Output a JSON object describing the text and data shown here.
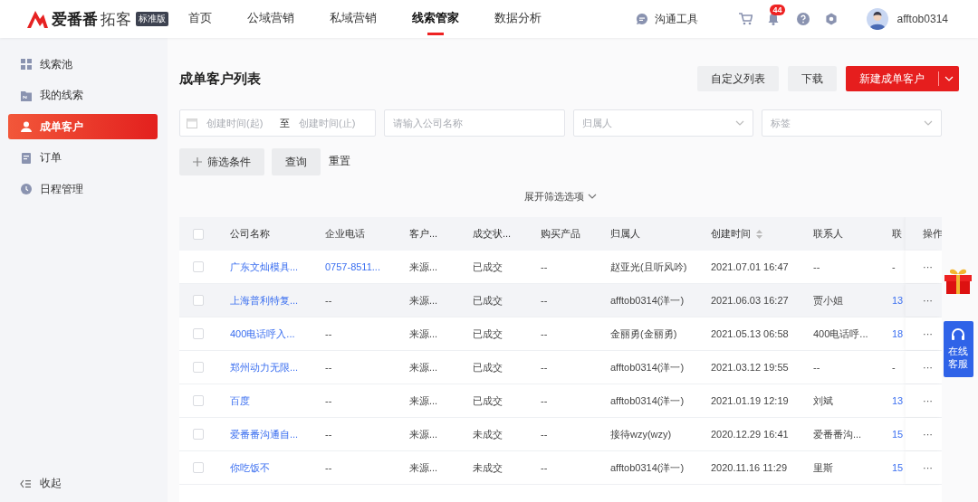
{
  "brand": {
    "name": "爱番番",
    "product": "拓客",
    "edition": "标准版"
  },
  "nav": [
    {
      "label": "首页",
      "selected": false
    },
    {
      "label": "公域营销",
      "selected": false
    },
    {
      "label": "私域营销",
      "selected": false
    },
    {
      "label": "线索管家",
      "selected": true
    },
    {
      "label": "数据分析",
      "selected": false
    }
  ],
  "toolbar": {
    "chat_tool": "沟通工具",
    "notification_count": "44",
    "username": "afftob0314"
  },
  "sidebar": {
    "items": [
      {
        "label": "线索池",
        "selected": false
      },
      {
        "label": "我的线索",
        "selected": false
      },
      {
        "label": "成单客户",
        "selected": true
      },
      {
        "label": "订单",
        "selected": false
      },
      {
        "label": "日程管理",
        "selected": false
      }
    ],
    "collapse": "收起"
  },
  "page": {
    "title": "成单客户列表",
    "buttons": [
      "自定义列表",
      "下载"
    ],
    "primary_button": "新建成单客户"
  },
  "filters": {
    "date_start": {
      "placeholder": "创建时间(起)"
    },
    "date_sep": "至",
    "date_end": {
      "placeholder": "创建时间(止)"
    },
    "company": {
      "placeholder": "请输入公司名称"
    },
    "owner": {
      "placeholder": "归属人"
    },
    "tag": {
      "placeholder": "标签"
    },
    "add_filter": "筛选条件",
    "query": "查询",
    "reset": "重置",
    "expand": "展开筛选选项"
  },
  "table": {
    "select_all_checked": false,
    "columns": [
      {
        "label": "公司名称",
        "sortable": false
      },
      {
        "label": "企业电话",
        "sortable": false
      },
      {
        "label": "客户...",
        "sortable": false
      },
      {
        "label": "成交状...",
        "sortable": false
      },
      {
        "label": "购买产品",
        "sortable": false
      },
      {
        "label": "归属人",
        "sortable": false
      },
      {
        "label": "创建时间",
        "sortable": true
      },
      {
        "label": "联系人",
        "sortable": false
      },
      {
        "label": "联",
        "sortable": false
      },
      {
        "label": "操作",
        "sortable": false
      }
    ],
    "rows": [
      {
        "checked": false,
        "highlighted": false,
        "cells": [
          {
            "text": "广东文灿模具...",
            "link": true
          },
          {
            "text": "0757-8511...",
            "link": true
          },
          {
            "text": "来源...",
            "link": false
          },
          {
            "text": "已成交",
            "link": false
          },
          {
            "text": "--",
            "link": false
          },
          {
            "text": "赵亚光(且听风吟)",
            "link": false
          },
          {
            "text": "2021.07.01 16:47",
            "link": false
          },
          {
            "text": "--",
            "link": false
          },
          {
            "text": "-",
            "link": false
          },
          {
            "text": "···",
            "link": false
          }
        ]
      },
      {
        "checked": false,
        "highlighted": true,
        "cells": [
          {
            "text": "上海普利特复...",
            "link": true
          },
          {
            "text": "--",
            "link": false
          },
          {
            "text": "来源...",
            "link": false
          },
          {
            "text": "已成交",
            "link": false
          },
          {
            "text": "--",
            "link": false
          },
          {
            "text": "afftob0314(洋一)",
            "link": false
          },
          {
            "text": "2021.06.03 16:27",
            "link": false
          },
          {
            "text": "贾小姐",
            "link": false
          },
          {
            "text": "13",
            "link": true
          },
          {
            "text": "···",
            "link": false
          }
        ]
      },
      {
        "checked": false,
        "highlighted": false,
        "cells": [
          {
            "text": "400电话呼入...",
            "link": true
          },
          {
            "text": "--",
            "link": false
          },
          {
            "text": "来源...",
            "link": false
          },
          {
            "text": "已成交",
            "link": false
          },
          {
            "text": "--",
            "link": false
          },
          {
            "text": "金丽勇(金丽勇)",
            "link": false
          },
          {
            "text": "2021.05.13 06:58",
            "link": false
          },
          {
            "text": "400电话呼...",
            "link": false
          },
          {
            "text": "18",
            "link": true
          },
          {
            "text": "···",
            "link": false
          }
        ]
      },
      {
        "checked": false,
        "highlighted": false,
        "cells": [
          {
            "text": "郑州动力无限...",
            "link": true
          },
          {
            "text": "--",
            "link": false
          },
          {
            "text": "来源...",
            "link": false
          },
          {
            "text": "已成交",
            "link": false
          },
          {
            "text": "--",
            "link": false
          },
          {
            "text": "afftob0314(洋一)",
            "link": false
          },
          {
            "text": "2021.03.12 19:55",
            "link": false
          },
          {
            "text": "--",
            "link": false
          },
          {
            "text": "-",
            "link": false
          },
          {
            "text": "···",
            "link": false
          }
        ]
      },
      {
        "checked": false,
        "highlighted": false,
        "cells": [
          {
            "text": "百度",
            "link": true
          },
          {
            "text": "--",
            "link": false
          },
          {
            "text": "来源...",
            "link": false
          },
          {
            "text": "已成交",
            "link": false
          },
          {
            "text": "--",
            "link": false
          },
          {
            "text": "afftob0314(洋一)",
            "link": false
          },
          {
            "text": "2021.01.19 12:19",
            "link": false
          },
          {
            "text": "刘斌",
            "link": false
          },
          {
            "text": "13",
            "link": true
          },
          {
            "text": "···",
            "link": false
          }
        ]
      },
      {
        "checked": false,
        "highlighted": false,
        "cells": [
          {
            "text": "爱番番沟通自...",
            "link": true
          },
          {
            "text": "--",
            "link": false
          },
          {
            "text": "来源...",
            "link": false
          },
          {
            "text": "未成交",
            "link": false
          },
          {
            "text": "--",
            "link": false
          },
          {
            "text": "接待wzy(wzy)",
            "link": false
          },
          {
            "text": "2020.12.29 16:41",
            "link": false
          },
          {
            "text": "爱番番沟...",
            "link": false
          },
          {
            "text": "15",
            "link": true
          },
          {
            "text": "···",
            "link": false
          }
        ]
      },
      {
        "checked": false,
        "highlighted": false,
        "cells": [
          {
            "text": "你吃饭不",
            "link": true
          },
          {
            "text": "--",
            "link": false
          },
          {
            "text": "来源...",
            "link": false
          },
          {
            "text": "未成交",
            "link": false
          },
          {
            "text": "--",
            "link": false
          },
          {
            "text": "afftob0314(洋一)",
            "link": false
          },
          {
            "text": "2020.11.16 11:29",
            "link": false
          },
          {
            "text": "里斯",
            "link": false
          },
          {
            "text": "15",
            "link": true
          },
          {
            "text": "···",
            "link": false
          }
        ]
      }
    ]
  },
  "floating": {
    "service": "在线客服"
  }
}
